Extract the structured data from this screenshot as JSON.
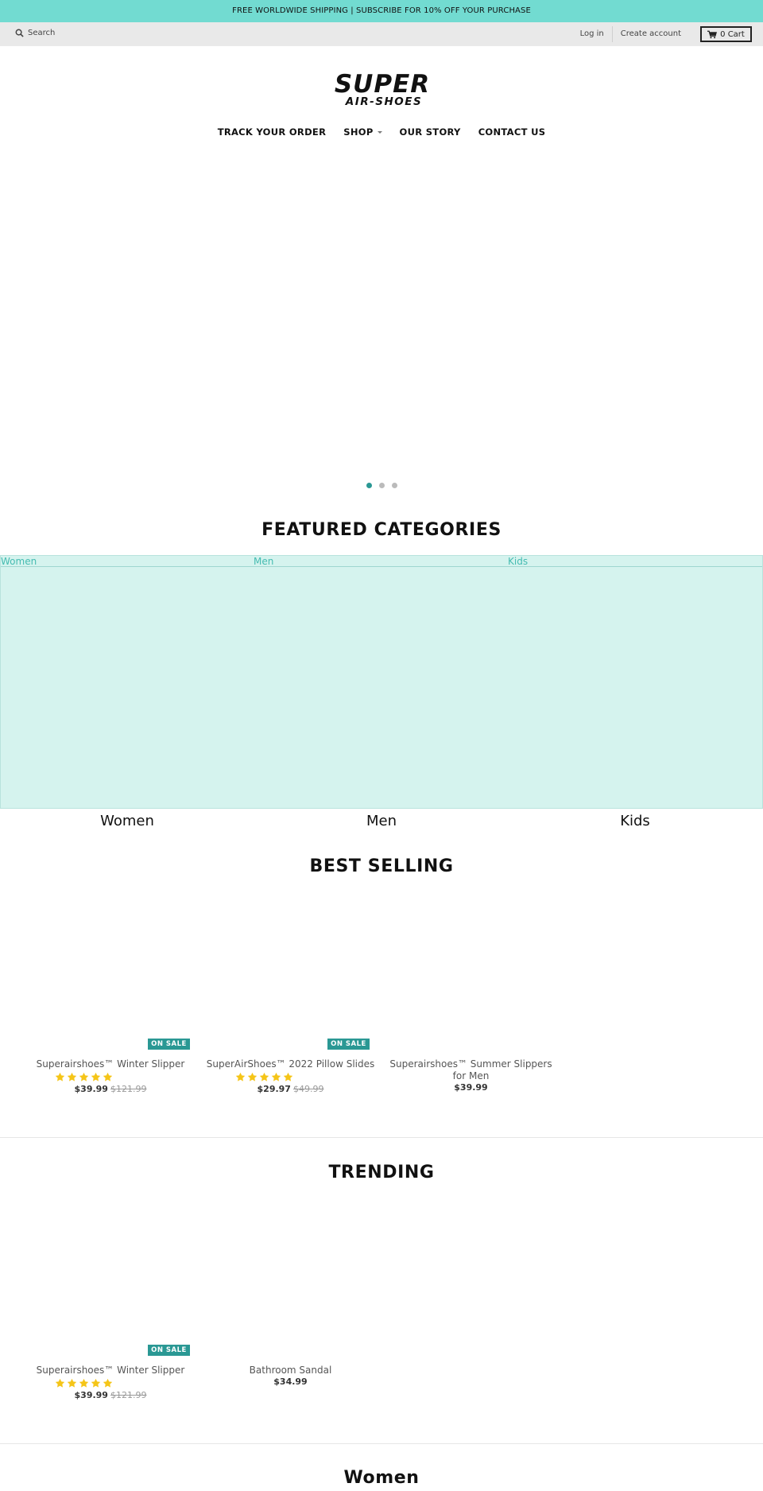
{
  "announcement": "FREE WORLDWIDE SHIPPING | SUBSCRIBE FOR 10% OFF YOUR PURCHASE",
  "util": {
    "search_label": "Search",
    "login": "Log in",
    "create_account": "Create account",
    "cart_label": "0 Cart"
  },
  "logo": {
    "line1": "SUPER",
    "line2": "AIR-SHOES"
  },
  "nav": {
    "track": "TRACK YOUR ORDER",
    "shop": "SHOP",
    "story": "OUR STORY",
    "contact": "CONTACT US"
  },
  "slider": {
    "slides": 3,
    "active": 1
  },
  "featured": {
    "title": "FEATURED CATEGORIES",
    "links": [
      "Women",
      "Men",
      "Kids"
    ],
    "names": [
      "Women",
      "Men",
      "Kids"
    ]
  },
  "best_selling": {
    "title": "BEST SELLING",
    "products": [
      {
        "badge": "ON SALE",
        "title": "Superairshoes™ Winter Slipper",
        "rating": 5,
        "price": "$39.99",
        "old_price": "$121.99"
      },
      {
        "badge": "ON SALE",
        "title": "SuperAirShoes™ 2022 Pillow Slides",
        "rating": 5,
        "price": "$29.97",
        "old_price": "$49.99"
      },
      {
        "title_line1": "Superairshoes™ Summer Slippers",
        "title_line2": "for Men",
        "price": "$39.99"
      }
    ]
  },
  "trending": {
    "title": "TRENDING",
    "products": [
      {
        "badge": "ON SALE",
        "title": "Superairshoes™ Winter Slipper",
        "rating": 5,
        "price": "$39.99",
        "old_price": "$121.99"
      },
      {
        "title": "Bathroom Sandal",
        "price": "$34.99"
      }
    ]
  },
  "women_section": {
    "title": "Women"
  },
  "colors": {
    "accent": "#72dbd1",
    "badge": "#2a9894",
    "star": "#f5c518",
    "category_bg": "#d5f3ee"
  }
}
